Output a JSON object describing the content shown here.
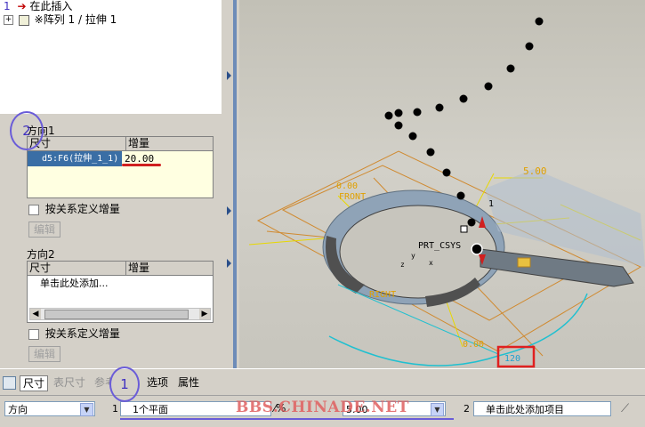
{
  "tree": {
    "items": [
      {
        "label": "在此插入",
        "number": "1"
      },
      {
        "label": "※阵列 1 / 拉伸 1"
      }
    ]
  },
  "direction1": {
    "title": "方向1",
    "col_dim": "尺寸",
    "col_inc": "增量",
    "row": {
      "dim": "d5:F6(拉伸_1_1)",
      "increment": "20.00"
    },
    "relation_label": "按关系定义增量",
    "edit_label": "编辑"
  },
  "direction2": {
    "title": "方向2",
    "col_dim": "尺寸",
    "col_inc": "增量",
    "add_hint": "单击此处添加...",
    "relation_label": "按关系定义增量",
    "edit_label": "编辑"
  },
  "viewport": {
    "labels": {
      "front": "FRONT",
      "right": "RIGHT",
      "csys": "PRT_CSYS",
      "dim_5": "5.00",
      "dim_top": "0.00",
      "dim_bottom": "0.00",
      "dim_boxed": "120",
      "marker_1": "1",
      "axis_y": "y",
      "axis_x": "x",
      "axis_z": "z"
    },
    "colors": {
      "pattern_dots": "#000000",
      "feature": "#8fa3b7",
      "annotation": "#e0a000",
      "highlight": "#e02020",
      "cyan": "#20c0d0"
    }
  },
  "dashboard": {
    "tabs": [
      "尺寸",
      "表尺寸",
      "参考",
      "选项",
      "属性"
    ],
    "direction_select": "方向",
    "slot1_num": "1",
    "plane_select": "1个平面",
    "value_select": "5.00",
    "slot2_num": "2",
    "slot2_hint": "单击此处添加项目"
  },
  "overlays": {
    "callouts": [
      "1",
      "2",
      "1"
    ],
    "watermark": "BBS.CHINADE.NET"
  }
}
